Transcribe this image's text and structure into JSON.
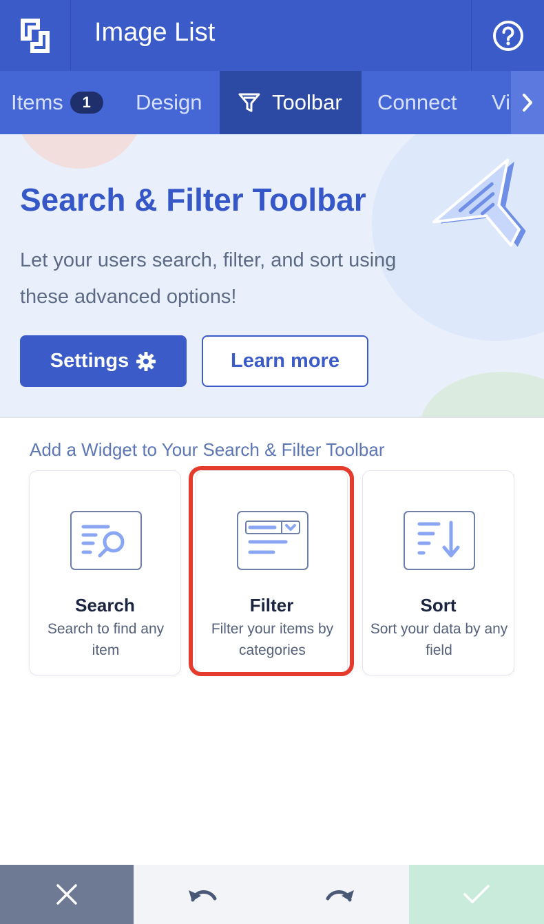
{
  "header": {
    "title": "Image List",
    "logo_icon": "brand-logo-icon",
    "help_icon": "question-circle-icon"
  },
  "tabs": [
    {
      "label": "Items",
      "badge": "1"
    },
    {
      "label": "Design"
    },
    {
      "label": "Toolbar",
      "icon": "filter-funnel-icon",
      "active": true
    },
    {
      "label": "Connect"
    },
    {
      "label": "Vi"
    }
  ],
  "hero": {
    "title": "Search & Filter Toolbar",
    "subtitle": "Let your users search, filter, and sort using these advanced options!",
    "settings_label": "Settings",
    "learn_more_label": "Learn more"
  },
  "widgets": {
    "section_title": "Add a Widget to Your Search & Filter Toolbar",
    "items": [
      {
        "name": "Search",
        "description": "Search to find any item",
        "icon": "search-widget-icon"
      },
      {
        "name": "Filter",
        "description": "Filter your items by categories",
        "icon": "filter-widget-icon",
        "highlighted": true
      },
      {
        "name": "Sort",
        "description": "Sort your data by any field",
        "icon": "sort-widget-icon"
      }
    ]
  },
  "colors": {
    "primary": "#3b5bc8",
    "tab_bar": "#4566d5",
    "tab_active": "#2c4aa4",
    "highlight": "#e53b2c",
    "confirm": "#c9ebdc",
    "cancel": "#6e7a94"
  }
}
